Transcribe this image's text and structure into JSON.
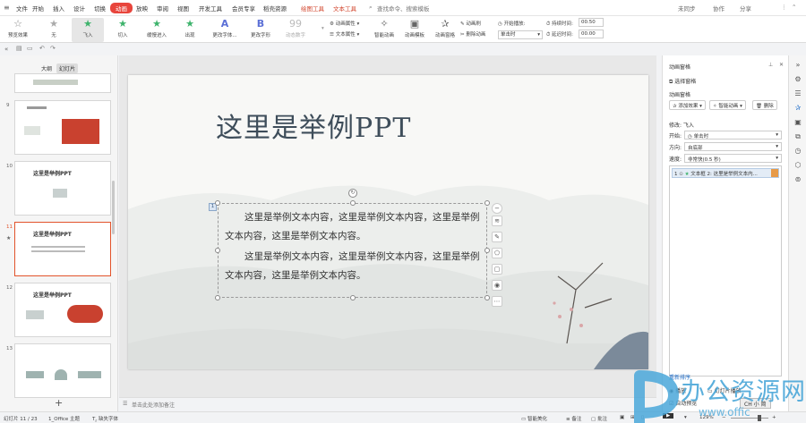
{
  "menubar": {
    "items": [
      "文件",
      "开始",
      "插入",
      "设计",
      "切换",
      "动画",
      "放映",
      "审阅",
      "视图",
      "开发工具",
      "会员专享",
      "稻壳资源",
      "绘图工具",
      "文本工具"
    ],
    "active": "动画",
    "search": "查找命令、搜索模板",
    "right": [
      "未同步",
      "协作",
      "分享"
    ]
  },
  "ribbon": {
    "preview": "预览效果",
    "effects": [
      "无",
      "飞入",
      "切入",
      "缓慢进入",
      "出现",
      "更改字体...",
      "更改字形",
      "动态数字"
    ],
    "attr1": "动画属性",
    "attr2": "文本属性",
    "smart": "智能动画",
    "template": "动画模板",
    "pane": "动画窗格",
    "brush": "动画刷",
    "remove": "删除动画",
    "start_label": "开始播放",
    "start_value": "单击时",
    "duration_label": "持续时间",
    "duration_value": "00.50",
    "delay_label": "延迟时间",
    "delay_value": "00.00"
  },
  "leftpanel": {
    "tabs": [
      "大纲",
      "幻灯片"
    ],
    "slides": [
      {
        "num": "9",
        "title": ""
      },
      {
        "num": "10",
        "title": "这里是举例PPT"
      },
      {
        "num": "11",
        "title": "这里是举例PPT"
      },
      {
        "num": "12",
        "title": "这里是举例PPT"
      },
      {
        "num": "13",
        "title": ""
      }
    ],
    "add": "+"
  },
  "slide": {
    "title": "这里是举例PPT",
    "para1": "这里是举例文本内容，这里是举例文本内容，这里是举例文本内容，这里是举例文本内容。",
    "para2": "这里是举例文本内容，这里是举例文本内容，这里是举例文本内容，这里是举例文本内容。",
    "tag": "1"
  },
  "notes": {
    "placeholder": "单击此处添加备注"
  },
  "rightpanel": {
    "title": "动画窗格",
    "select_pane": "选择窗格",
    "section": "动画窗格",
    "add_effect": "添加效果",
    "smart_anim": "智能动画",
    "delete": "删除",
    "modify": "修改: 飞入",
    "start_label": "开始:",
    "start_value": "单击时",
    "dir_label": "方向:",
    "dir_value": "自底部",
    "speed_label": "速度:",
    "speed_value": "非常快(0.5 秒)",
    "item_num": "1",
    "item_text": "文本框 2: 这里是举例文本内...",
    "reorder": "重新排序",
    "play": "播放",
    "slideshow": "幻灯片播放",
    "autopreview": "自动预览"
  },
  "statusbar": {
    "slide": "幻灯片 11 / 23",
    "theme": "1_Office 主题",
    "font": "缺失字体",
    "beautify": "智能美化",
    "notes": "备注",
    "comment": "批注",
    "zoom": "129%",
    "ime": "CH 小 简"
  },
  "watermark": {
    "text": "办公资源网",
    "url": "www.offic"
  },
  "colors": {
    "accent": "#e8453c",
    "title": "#3e4d5a",
    "selection": "#e2532b"
  }
}
